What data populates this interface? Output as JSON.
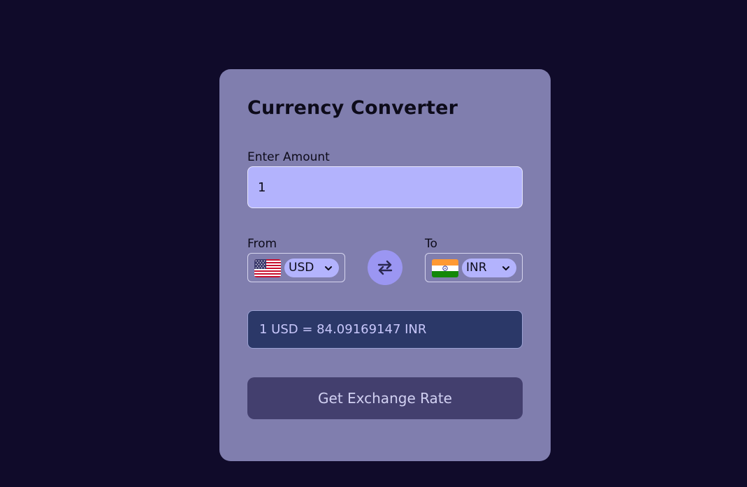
{
  "title": "Currency Converter",
  "amount": {
    "label": "Enter Amount",
    "value": "1"
  },
  "from": {
    "label": "From",
    "currency": "USD",
    "flag": "us-flag"
  },
  "to": {
    "label": "To",
    "currency": "INR",
    "flag": "india-flag"
  },
  "swap_icon": "swap-arrows-icon",
  "result_text": "1 USD = 84.09169147 INR",
  "button_label": "Get Exchange Rate",
  "colors": {
    "background": "#100b2a",
    "card": "#807eae",
    "input": "#b3b3fd",
    "result": "#2b3868",
    "button": "#433f6e",
    "swap": "#9b96f2"
  }
}
